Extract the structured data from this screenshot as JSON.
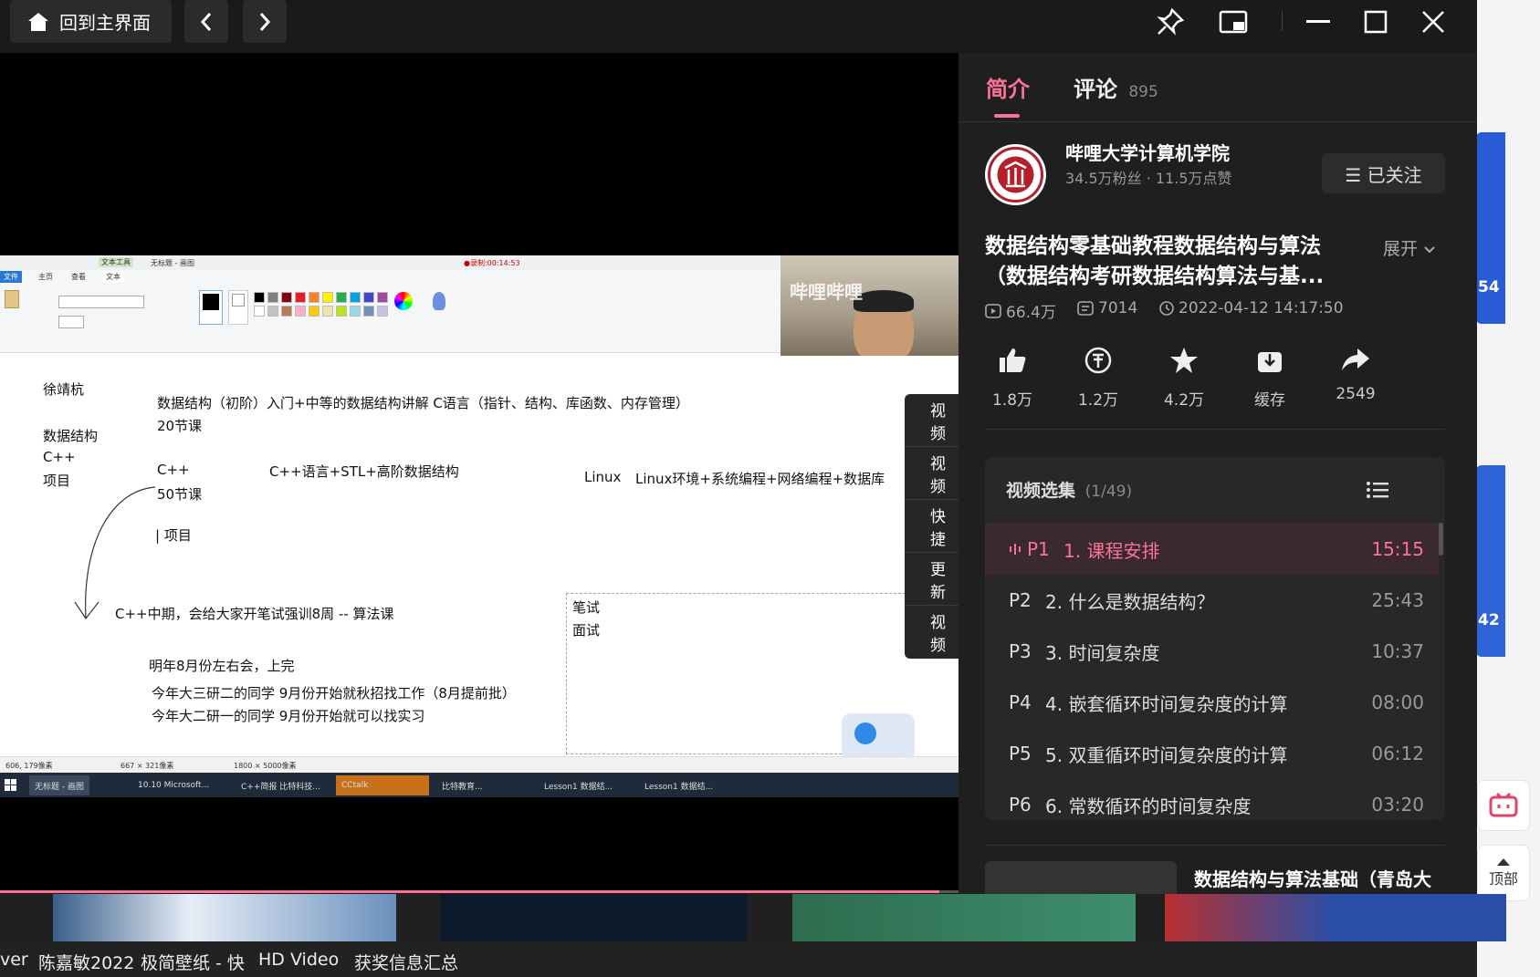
{
  "topbar": {
    "home_label": "回到主界面"
  },
  "video": {
    "watermark": "哔哩哔哩",
    "ribbon": {
      "title": "无标题 - 画图",
      "recording": "●录制:00:14:53",
      "tabs": [
        "文件",
        "主页",
        "查看",
        "文本"
      ],
      "active_tab_context": "文本工具"
    },
    "canvas_lines": [
      "徐靖杭",
      "数据结构（初阶）入门+中等的数据结构讲解    C语言（指针、结构、库函数、内存管理）",
      "20节课",
      "数据结构",
      "C++",
      "项目",
      "C++",
      "C++语言+STL+高阶数据结构",
      "50节课",
      "Linux",
      "Linux环境+系统编程+网络编程+数据库",
      "| 项目",
      "C++中期，会给大家开笔试强训8周  -- 算法课",
      "笔试",
      "面试",
      "明年8月份左右会，上完",
      "今年大三研二的同学 9月份开始就秋招找工作（8月提前批）",
      "今年大二研一的同学  9月份开始就可以找实习"
    ],
    "statusbar": [
      "606, 179像素",
      "667 × 321像素",
      "1800 × 5000像素"
    ],
    "taskbar": [
      "无标题 - 画图",
      "10.10 Microsoft...",
      "C++简报 比特科技...",
      "CCtalk",
      "比特教育...",
      "Lesson1 数据结...",
      "Lesson1 数据结..."
    ],
    "side_menu": [
      "视频",
      "视频",
      "快捷",
      "更新",
      "视频"
    ],
    "progress_ratio": 0.98
  },
  "panel": {
    "tabs": [
      {
        "label": "简介",
        "active": true
      },
      {
        "label": "评论",
        "count": "895",
        "active": false
      }
    ],
    "uploader": {
      "name": "哔哩大学计算机学院",
      "stats": "34.5万粉丝 · 11.5万点赞",
      "follow_label": "☰ 已关注"
    },
    "video_title": "数据结构零基础教程数据结构与算法（数据结构考研数据结构算法与基...",
    "expand_label": "展开",
    "meta": {
      "views": "66.4万",
      "danmaku": "7014",
      "date": "2022-04-12 14:17:50"
    },
    "actions": [
      {
        "icon": "like-icon",
        "label": "1.8万"
      },
      {
        "icon": "coin-icon",
        "label": "1.2万"
      },
      {
        "icon": "star-icon",
        "label": "4.2万"
      },
      {
        "icon": "download-icon",
        "label": "缓存"
      },
      {
        "icon": "share-icon",
        "label": "2549"
      }
    ],
    "playlist": {
      "title": "视频选集",
      "count": "(1/49)",
      "episodes": [
        {
          "p": "P1",
          "title": "1. 课程安排",
          "duration": "15:15",
          "active": true
        },
        {
          "p": "P2",
          "title": "2. 什么是数据结构？",
          "duration": "25:43",
          "active": false
        },
        {
          "p": "P3",
          "title": "3. 时间复杂度",
          "duration": "10:37",
          "active": false
        },
        {
          "p": "P4",
          "title": "4. 嵌套循环时间复杂度的计算",
          "duration": "08:00",
          "active": false
        },
        {
          "p": "P5",
          "title": "5. 双重循环时间复杂度的计算",
          "duration": "06:12",
          "active": false
        },
        {
          "p": "P6",
          "title": "6. 常数循环的时间复杂度",
          "duration": "03:20",
          "active": false
        }
      ]
    },
    "recommend_title": "数据结构与算法基础（青岛大"
  },
  "sidebar": {
    "top_label": "顶部"
  },
  "background": {
    "card_numbers": [
      "54",
      "42"
    ]
  },
  "bottom_labels": [
    "ver",
    "陈嘉敏2022",
    "极简壁纸 - 快",
    "HD Video",
    "获奖信息汇总"
  ],
  "colors": {
    "accent": "#fb7299",
    "panel_bg": "#1f1f1f",
    "topbar_bg": "#1a1a1a"
  }
}
